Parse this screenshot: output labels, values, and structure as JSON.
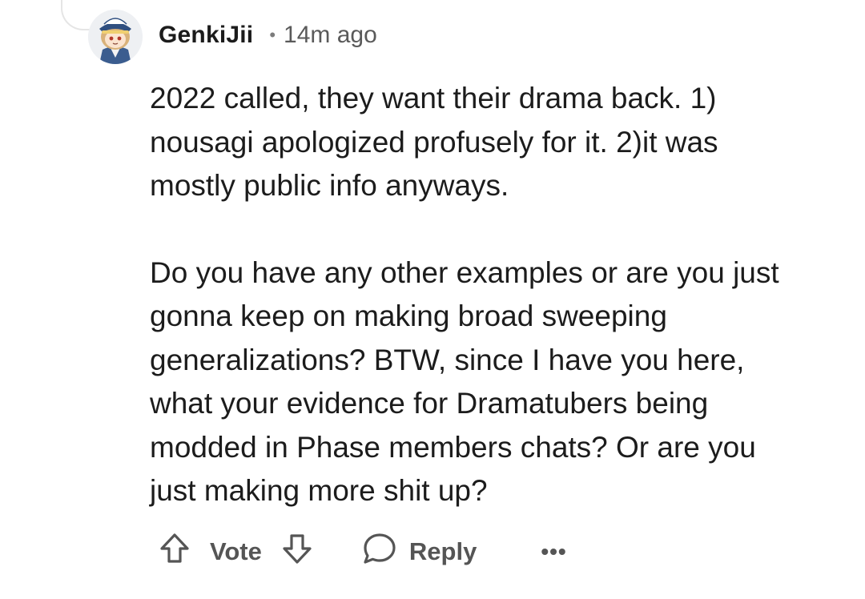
{
  "comment": {
    "author": "GenkiJii",
    "separator": "•",
    "time": "14m ago",
    "paragraphs": [
      "2022 called, they want their drama back. 1)\nnousagi apologized profusely for it. 2)it was\nmostly public info anyways.",
      "Do you have any other examples or are you just\ngonna keep on making broad sweeping\ngeneralizations? BTW, since I have you here,\nwhat your evidence for Dramatubers being\nmodded in Phase members chats? Or are you\njust making more shit up?"
    ]
  },
  "actions": {
    "upvote_icon": "arrow-up-outline-icon",
    "vote_label": "Vote",
    "downvote_icon": "arrow-down-outline-icon",
    "reply_icon": "speech-bubble-icon",
    "reply_label": "Reply",
    "more_label": "•••"
  },
  "colors": {
    "text": "#1c1c1c",
    "muted": "#5a5a5a",
    "icon": "#555555",
    "thread_line": "#e5e5e5"
  }
}
